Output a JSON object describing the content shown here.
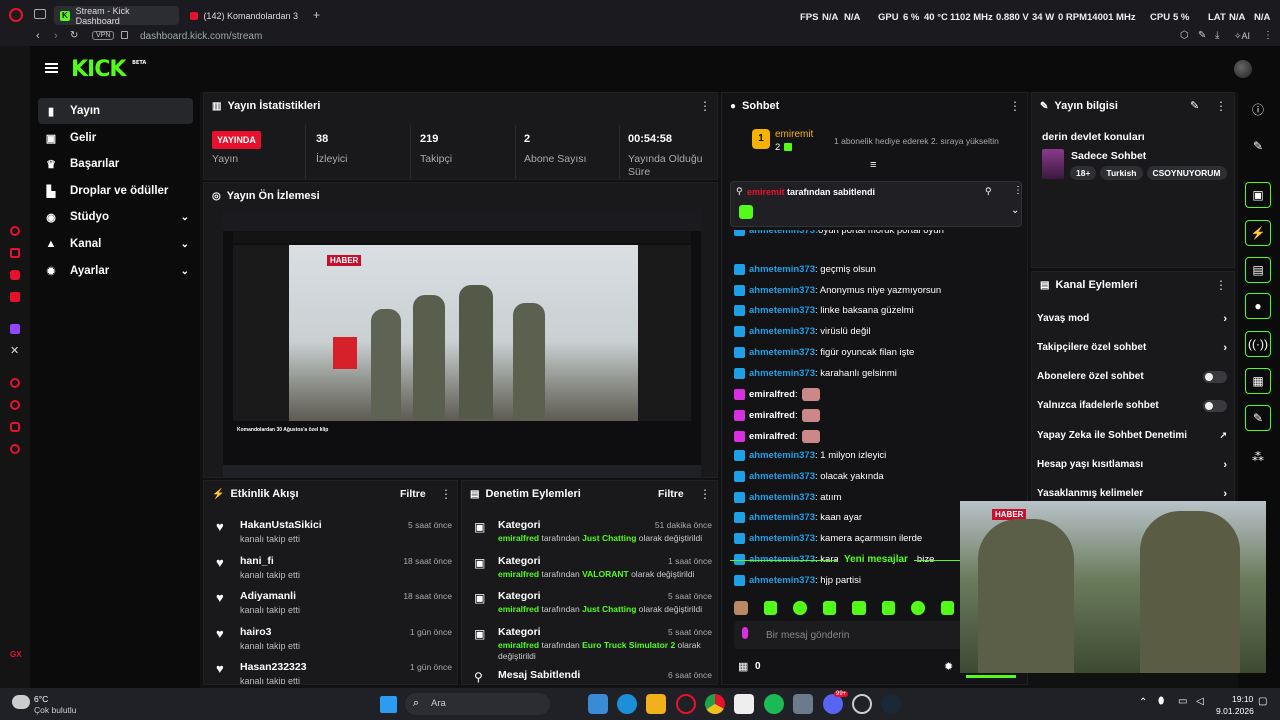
{
  "browser": {
    "tabs": [
      {
        "label": "Stream - Kick Dashboard",
        "active": true
      },
      {
        "label": "(142) Komandolardan 3",
        "active": false
      }
    ],
    "url": "dashboard.kick.com/stream",
    "vpn": "VPN",
    "ai_label": "AI"
  },
  "hud": {
    "fps_label": "FPS",
    "fps_value": "N/A",
    "fps_value2": "N/A",
    "gpu_label": "GPU",
    "gpu_pct": "6 %",
    "gpu_temp": "40 °C",
    "gpu_clock": "1102 MHz",
    "gpu_volt": "0.880 V",
    "gpu_power": "34 W",
    "gpu_fan": "0 RPM",
    "gpu_mem": "14001 MHz",
    "cpu_label": "CPU",
    "cpu_pct": "5 %",
    "lat_label": "LAT",
    "lat_v1": "N/A",
    "lat_v2": "N/A"
  },
  "header": {
    "logo": "KICK",
    "beta": "BETA"
  },
  "nav": [
    {
      "label": "Yayın",
      "icon": "broadcast-icon",
      "glyph": "▮"
    },
    {
      "label": "Gelir",
      "icon": "revenue-icon",
      "glyph": "▣"
    },
    {
      "label": "Başarılar",
      "icon": "trophy-icon",
      "glyph": "♛"
    },
    {
      "label": "Droplar ve ödüller",
      "icon": "drops-icon",
      "glyph": "▙"
    },
    {
      "label": "Stüdyo",
      "icon": "studio-icon",
      "glyph": "◉"
    },
    {
      "label": "Kanal",
      "icon": "channel-icon",
      "glyph": "▲"
    },
    {
      "label": "Ayarlar",
      "icon": "settings-icon",
      "glyph": "✹"
    }
  ],
  "stats": {
    "title": "Yayın İstatistikleri",
    "live_badge": "YAYINDA",
    "live_label": "Yayın",
    "items": [
      {
        "value": "38",
        "label": "İzleyici"
      },
      {
        "value": "219",
        "label": "Takipçi"
      },
      {
        "value": "2",
        "label": "Abone Sayısı"
      },
      {
        "value": "00:54:58",
        "label": "Yayında Olduğu Süre"
      }
    ]
  },
  "preview": {
    "title": "Yayın Ön İzlemesi",
    "inner_badge": "HABER",
    "inner_caption": "Komandolardan 30 Ağustos'a özel klip"
  },
  "activity": {
    "title": "Etkinlik Akışı",
    "filter": "Filtre",
    "items": [
      {
        "name": "HakanUstaSikici",
        "action": "kanalı takip etti",
        "time": "5 saat önce"
      },
      {
        "name": "hani_fi",
        "action": "kanalı takip etti",
        "time": "18 saat önce"
      },
      {
        "name": "Adiyamanli",
        "action": "kanalı takip etti",
        "time": "18 saat önce"
      },
      {
        "name": "hairo3",
        "action": "kanalı takip etti",
        "time": "1 gün önce"
      },
      {
        "name": "Hasan232323",
        "action": "kanalı takip etti",
        "time": "1 gün önce"
      }
    ]
  },
  "moderation": {
    "title": "Denetim Eylemleri",
    "filter": "Filtre",
    "items": [
      {
        "name": "Kategori",
        "user": "emiralfred",
        "mid": " tarafından ",
        "cat": "Just Chatting",
        "tail": " olarak değiştirildi",
        "time": "51 dakika önce"
      },
      {
        "name": "Kategori",
        "user": "emiralfred",
        "mid": " tarafından ",
        "cat": "VALORANT",
        "tail": " olarak değiştirildi",
        "time": "1 saat önce"
      },
      {
        "name": "Kategori",
        "user": "emiralfred",
        "mid": " tarafından ",
        "cat": "Just Chatting",
        "tail": " olarak değiştirildi",
        "time": "5 saat önce"
      },
      {
        "name": "Kategori",
        "user": "emiralfred",
        "mid": " tarafından ",
        "cat": "Euro Truck Simulator 2",
        "tail": " olarak değiştirildi",
        "time": "5 saat önce"
      },
      {
        "name": "Mesaj Sabitlendi",
        "user": "",
        "mid": "",
        "cat": "",
        "tail": "",
        "time": "6 saat önce"
      }
    ]
  },
  "chat": {
    "title": "Sohbet",
    "gift_user": "emiremit",
    "gift_count": "2",
    "gift_text": "1 abonelik hediye ederek 2. sıraya yükseltin",
    "pinned_user": "emiremit",
    "pinned_text": " tarafından sabitlendi",
    "partial_line": "oyun portal moruk portal oyun",
    "messages": [
      {
        "user": "ahmetemin373",
        "text": ": geçmiş olsun"
      },
      {
        "user": "ahmetemin373",
        "text": ": Anonymus niye yazmıyorsun"
      },
      {
        "user": "ahmetemin373",
        "text": ": linke baksana güzelmi"
      },
      {
        "user": "ahmetemin373",
        "text": ": virüslü değil"
      },
      {
        "user": "ahmetemin373",
        "text": ": figür oyuncak filan işte"
      },
      {
        "user": "ahmetemin373",
        "text": ": karahanlı gelsinmi"
      },
      {
        "user": "emiralfred",
        "text": ":",
        "emote": true
      },
      {
        "user": "emiralfred",
        "text": ":",
        "emote": true
      },
      {
        "user": "emiralfred",
        "text": ":",
        "emote": true
      },
      {
        "user": "ahmetemin373",
        "text": ": 1 milyon izleyici"
      },
      {
        "user": "ahmetemin373",
        "text": ": olacak yakında"
      },
      {
        "user": "ahmetemin373",
        "text": ": atıım"
      },
      {
        "user": "ahmetemin373",
        "text": ": kaan ayar"
      },
      {
        "user": "ahmetemin373",
        "text": ": kamera açarmısın ilerde"
      },
      {
        "user": "ahmetemin373",
        "text": ": karahan trol yapmasın bize"
      }
    ],
    "new_messages": "Yeni mesajlar",
    "last": {
      "user": "ahmetemin373",
      "text": ": hjp partisi"
    },
    "input_placeholder": "Bir mesaj gönderin",
    "count": "0"
  },
  "info": {
    "title": "Yayın bilgisi",
    "stream_title": "derin devlet konuları",
    "category": "Sadece Sohbet",
    "tags": [
      "18+",
      "Turkish",
      "CSOYNUYORUM"
    ]
  },
  "channel_actions": {
    "title": "Kanal Eylemleri",
    "items": [
      {
        "label": "Yavaş mod",
        "kind": "chevron"
      },
      {
        "label": "Takipçilere özel sohbet",
        "kind": "chevron"
      },
      {
        "label": "Abonelere özel sohbet",
        "kind": "toggle"
      },
      {
        "label": "Yalnızca ifadelerle sohbet",
        "kind": "toggle"
      },
      {
        "label": "Yapay Zeka ile Sohbet Denetimi",
        "kind": "external"
      },
      {
        "label": "Hesap yaşı kısıtlaması",
        "kind": "chevron"
      },
      {
        "label": "Yasaklanmış kelimeler",
        "kind": "chevron"
      }
    ]
  },
  "overlay_video": {
    "badge": "HABER"
  },
  "taskbar": {
    "weather_temp": "6°C",
    "weather_desc": "Çok bulutlu",
    "search_placeholder": "Ara",
    "time": "19:10",
    "date": "9.01.2026",
    "badge": "99+"
  },
  "colors": {
    "kick_green": "#53fc18",
    "live_red": "#e8112d",
    "chat_user": "#1ea0e6",
    "mod_user": "#d82fe1"
  }
}
